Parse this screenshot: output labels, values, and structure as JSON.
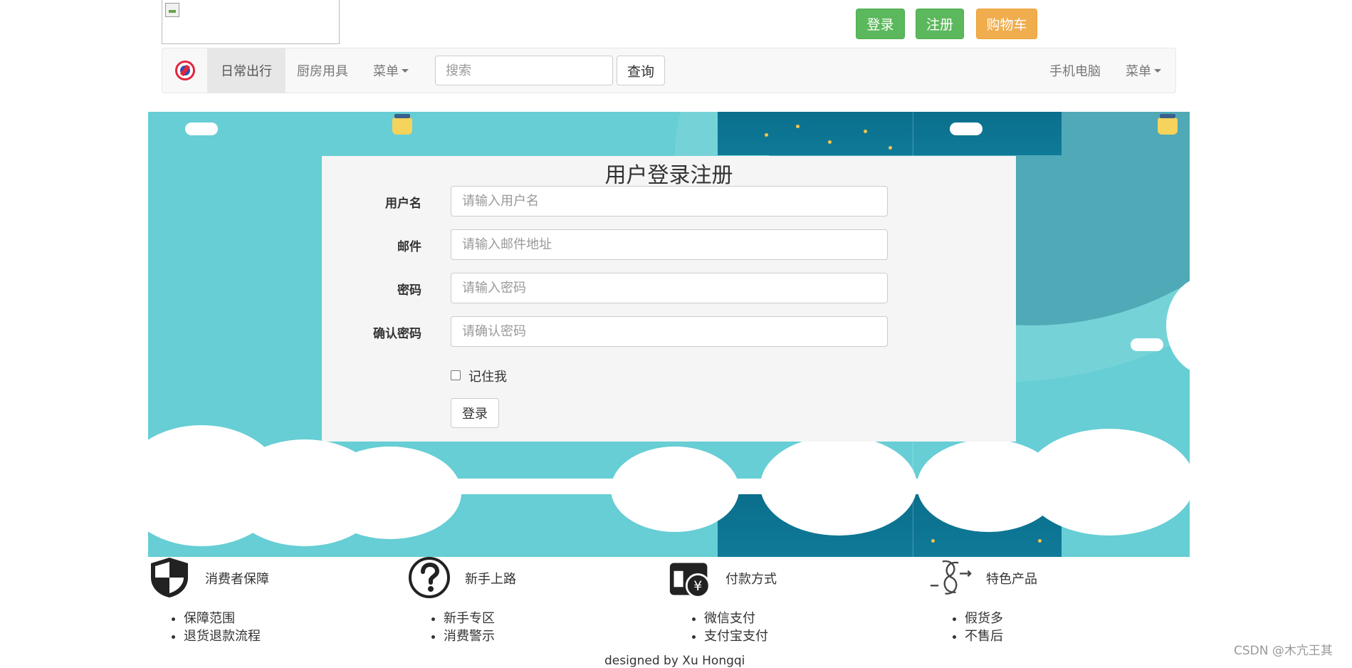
{
  "top_actions": {
    "login_label": "登录",
    "register_label": "注册",
    "cart_label": "购物车"
  },
  "navbar": {
    "items": [
      {
        "label": "日常出行"
      },
      {
        "label": "厨房用具"
      },
      {
        "label": "菜单"
      }
    ],
    "search_placeholder": "搜索",
    "query_label": "查询",
    "right_items": [
      {
        "label": "手机电脑"
      },
      {
        "label": "菜单"
      }
    ]
  },
  "form": {
    "title": "用户登录注册",
    "fields": [
      {
        "label": "用户名",
        "placeholder": "请输入用户名"
      },
      {
        "label": "邮件",
        "placeholder": "请输入邮件地址"
      },
      {
        "label": "密码",
        "placeholder": "请输入密码"
      },
      {
        "label": "确认密码",
        "placeholder": "请确认密码"
      }
    ],
    "remember_label": "记住我",
    "submit_label": "登录"
  },
  "footer": {
    "columns": [
      {
        "icon": "shield-icon",
        "title": "消费者保障",
        "links": [
          "保障范围",
          "退货退款流程"
        ]
      },
      {
        "icon": "question-icon",
        "title": "新手上路",
        "links": [
          "新手专区",
          "消费警示"
        ]
      },
      {
        "icon": "payment-icon",
        "title": "付款方式",
        "links": [
          "微信支付",
          "支付宝支付"
        ]
      },
      {
        "icon": "special-product-icon",
        "title": "特色产品",
        "links": [
          "假货多",
          "不售后"
        ]
      }
    ],
    "designed_by": "designed by Xu Hongqi"
  },
  "watermark": "CSDN @木亢王其",
  "colors": {
    "success": "#5cb85c",
    "warning": "#f0ad4e",
    "banner_sky": "#66ced4",
    "banner_dark": "#0a6f8c"
  }
}
